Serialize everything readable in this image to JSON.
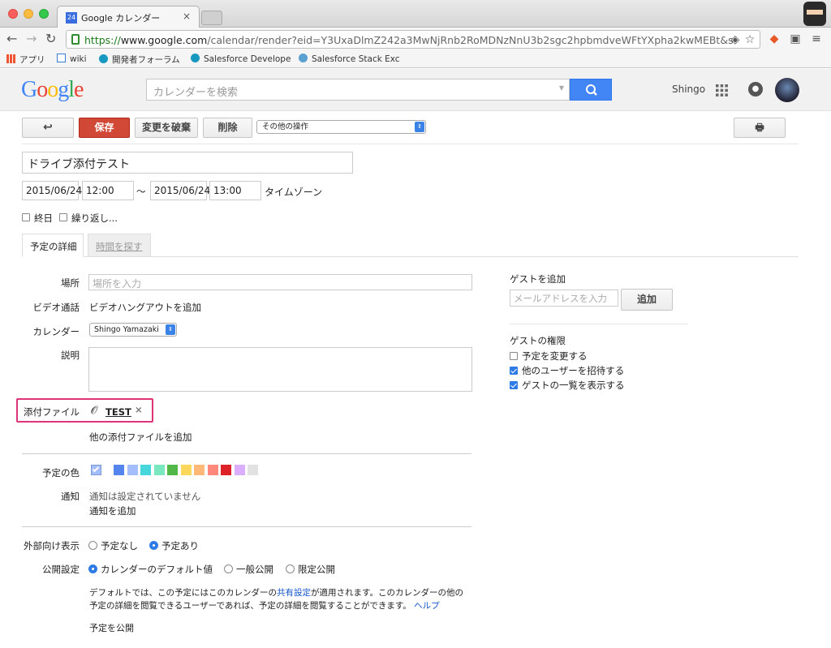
{
  "browser": {
    "tab_title": "Google カレンダー",
    "tab_favicon": "24",
    "url_prefix": "https://",
    "url_host": "www.google.com",
    "url_rest": "/calendar/render?eid=Y3UxaDlmZ242a3MwNjRnb2RoMDNzNnU3b2sgc2hpbmdveWFtYXpha2kwMEBt&sf=true&...",
    "bookmarks": [
      {
        "label": "アプリ",
        "icon": "apps-grid-icon"
      },
      {
        "label": "wiki",
        "icon": "page-icon"
      },
      {
        "label": "開発者フォーラム",
        "icon": "cloud-icon"
      },
      {
        "label": "Salesforce Develope",
        "icon": "cloud-icon"
      },
      {
        "label": "Salesforce Stack Exc",
        "icon": "stack-icon"
      }
    ]
  },
  "header": {
    "logo": "Google",
    "search_placeholder": "カレンダーを検索",
    "user_name": "Shingo"
  },
  "actions": {
    "save": "保存",
    "discard": "変更を破棄",
    "delete": "削除",
    "more_actions": "その他の操作"
  },
  "event": {
    "title": "ドライブ添付テスト",
    "start_date": "2015/06/24",
    "start_time": "12:00",
    "separator": "～",
    "end_date": "2015/06/24",
    "end_time": "13:00",
    "timezone_link": "タイムゾーン",
    "all_day": "終日",
    "repeat": "繰り返し..."
  },
  "tabs": [
    "予定の詳細",
    "時間を探す"
  ],
  "details": {
    "location_label": "場所",
    "location_placeholder": "場所を入力",
    "video_label": "ビデオ通話",
    "video_link": "ビデオハングアウトを追加",
    "calendar_label": "カレンダー",
    "calendar_value": "Shingo Yamazaki",
    "description_label": "説明",
    "attachment_label": "添付ファイル",
    "attachment_name": "TEST",
    "add_attachment": "他の添付ファイルを追加",
    "color_label": "予定の色",
    "notification_label": "通知",
    "notification_status": "通知は設定されていません",
    "add_notification": "通知を追加",
    "availability_label": "外部向け表示",
    "availability_options": [
      "予定なし",
      "予定あり"
    ],
    "availability_selected": 1,
    "privacy_label": "公開設定",
    "privacy_options": [
      "カレンダーのデフォルト値",
      "一般公開",
      "限定公開"
    ],
    "privacy_selected": 0,
    "privacy_note_1": "デフォルトでは、この予定にはこのカレンダーの",
    "privacy_note_link": "共有設定",
    "privacy_note_2": "が適用されます。このカレンダーの他の",
    "privacy_note_3": "予定の詳細を閲覧できるユーザーであれば、予定の詳細を閲覧することができます。",
    "help_link": "ヘルプ",
    "publish_link": "予定を公開"
  },
  "colors": [
    "#a4bdfc",
    "#5484ed",
    "#a4bdfc",
    "#46d6db",
    "#7ae7bf",
    "#51b749",
    "#fbd75b",
    "#ffb878",
    "#ff887c",
    "#dc2127",
    "#dbadff",
    "#e1e1e1"
  ],
  "guests": {
    "add_label": "ゲストを追加",
    "email_placeholder": "メールアドレスを入力",
    "add_button": "追加",
    "permissions_label": "ゲストの権限",
    "permissions": [
      {
        "label": "予定を変更する",
        "checked": false
      },
      {
        "label": "他のユーザーを招待する",
        "checked": true
      },
      {
        "label": "ゲストの一覧を表示する",
        "checked": true
      }
    ]
  }
}
